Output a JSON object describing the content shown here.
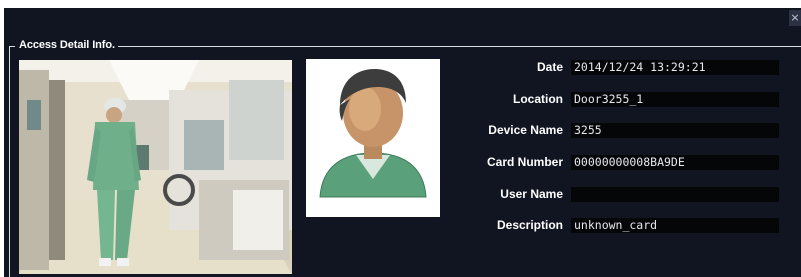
{
  "window": {
    "close_glyph": "×"
  },
  "group": {
    "title": "Access Detail Info."
  },
  "photo": {
    "icon": "snapshot-photo"
  },
  "avatar": {
    "icon": "user-avatar-icon"
  },
  "fields": [
    {
      "label": "Date",
      "value": "2014/12/24 13:29:21"
    },
    {
      "label": "Location",
      "value": "Door3255_1"
    },
    {
      "label": "Device Name",
      "value": "3255"
    },
    {
      "label": "Card Number",
      "value": "00000000008BA9DE"
    },
    {
      "label": "User Name",
      "value": ""
    },
    {
      "label": "Description",
      "value": "unknown_card"
    }
  ]
}
